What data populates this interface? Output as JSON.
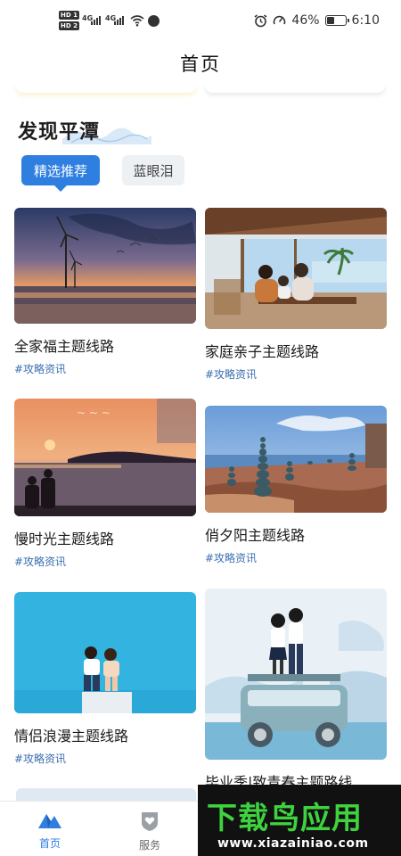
{
  "status_bar": {
    "hd1": "HD 1",
    "hd2": "HD 2",
    "net1": "4G",
    "net2": "4G",
    "battery_text": "46%",
    "battery_level": 0.46,
    "time": "6:10"
  },
  "header": {
    "title": "首页"
  },
  "section": {
    "title": "发现平潭"
  },
  "tabs": [
    {
      "label": "精选推荐",
      "active": true
    },
    {
      "label": "蓝眼泪",
      "active": false
    }
  ],
  "cards": [
    {
      "title": "全家福主题线路",
      "tag": "#攻略资讯",
      "image": "wind-turbines-sunset-beach"
    },
    {
      "title": "家庭亲子主题线路",
      "tag": "#攻略资讯",
      "image": "family-cafe-seaside"
    },
    {
      "title": "慢时光主题线路",
      "tag": "#攻略资讯",
      "image": "couple-sunset-sea"
    },
    {
      "title": "俏夕阳主题线路",
      "tag": "#攻略资讯",
      "image": "stone-cairns-coast"
    },
    {
      "title": "情侣浪漫主题线路",
      "tag": "#攻略资讯",
      "image": "couple-blue-backdrop"
    },
    {
      "title": "毕业季|致青春主题路线",
      "tag": "",
      "image": "illustrated-graduates-van"
    }
  ],
  "bottom_nav": [
    {
      "label": "首页",
      "icon": "mountain-icon",
      "active": true
    },
    {
      "label": "服务",
      "icon": "heart-shield-icon",
      "active": false
    }
  ],
  "watermark": {
    "main": "下载鸟应用",
    "sub": "www.xiazainiao.com"
  },
  "colors": {
    "accent": "#2e7fe0",
    "tag": "#3b6fb0",
    "watermark_green": "#3fd23f"
  }
}
